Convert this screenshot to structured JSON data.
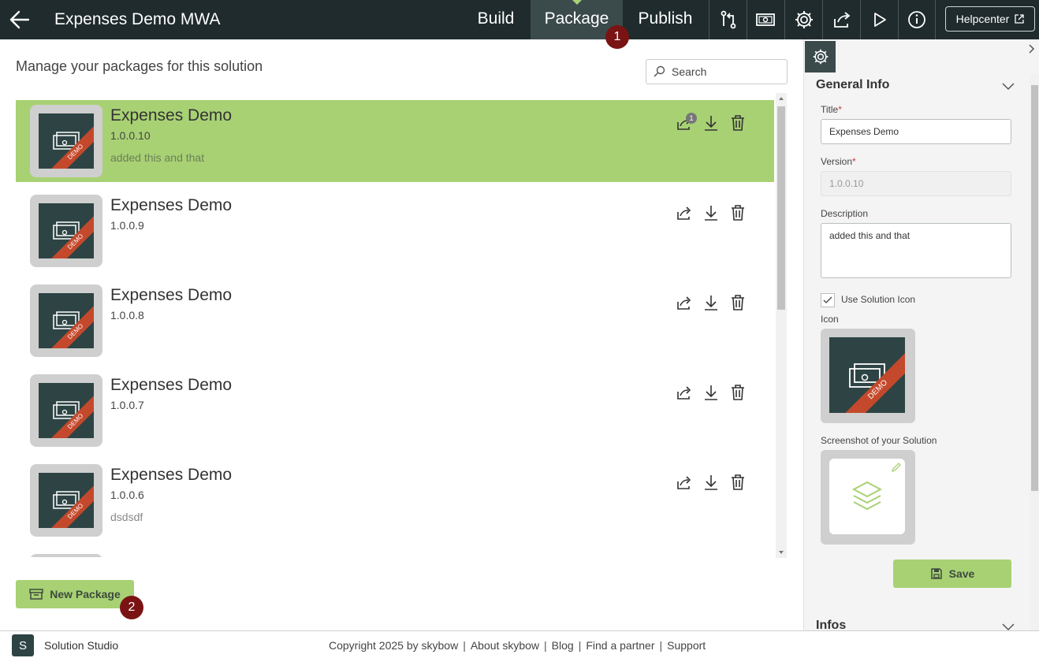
{
  "header": {
    "app_title": "Expenses Demo MWA",
    "tabs": [
      {
        "label": "Build",
        "active": false
      },
      {
        "label": "Package",
        "active": true
      },
      {
        "label": "Publish",
        "active": false
      }
    ],
    "toolbar_icons": [
      "git-compare-icon",
      "cash-icon",
      "gear-icon",
      "share-icon",
      "play-icon",
      "info-icon"
    ],
    "helpcenter_label": "Helpcenter"
  },
  "markers": [
    "1",
    "2"
  ],
  "main": {
    "heading": "Manage your packages for this solution",
    "search_placeholder": "Search",
    "packages": [
      {
        "title": "Expenses Demo",
        "version": "1.0.0.10",
        "description": "added this and that",
        "selected": true,
        "share_badge": "1"
      },
      {
        "title": "Expenses Demo",
        "version": "1.0.0.9",
        "description": "",
        "selected": false
      },
      {
        "title": "Expenses Demo",
        "version": "1.0.0.8",
        "description": "",
        "selected": false
      },
      {
        "title": "Expenses Demo",
        "version": "1.0.0.7",
        "description": "",
        "selected": false
      },
      {
        "title": "Expenses Demo",
        "version": "1.0.0.6",
        "description": "dsdsdf",
        "selected": false
      }
    ],
    "thumb_ribbon": "DEMO",
    "new_package_label": "New Package"
  },
  "panel": {
    "general_info": "General Info",
    "title_label": "Title",
    "title_value": "Expenses Demo",
    "version_label": "Version",
    "version_value": "1.0.0.10",
    "description_label": "Description",
    "description_value": "added this and that",
    "use_icon_label": "Use Solution Icon",
    "use_icon_checked": true,
    "icon_label": "Icon",
    "screenshot_label": "Screenshot of your Solution",
    "save_label": "Save",
    "infos": "Infos"
  },
  "footer": {
    "logo_letter": "S",
    "brand": "Solution Studio",
    "links": [
      "Copyright 2025 by skybow",
      "About skybow",
      "Blog",
      "Find a partner",
      "Support"
    ]
  },
  "colors": {
    "topbar": "#1f2b2c",
    "accent_green": "#a8d174",
    "marker": "#7a1414",
    "ribbon": "#c4492c"
  }
}
